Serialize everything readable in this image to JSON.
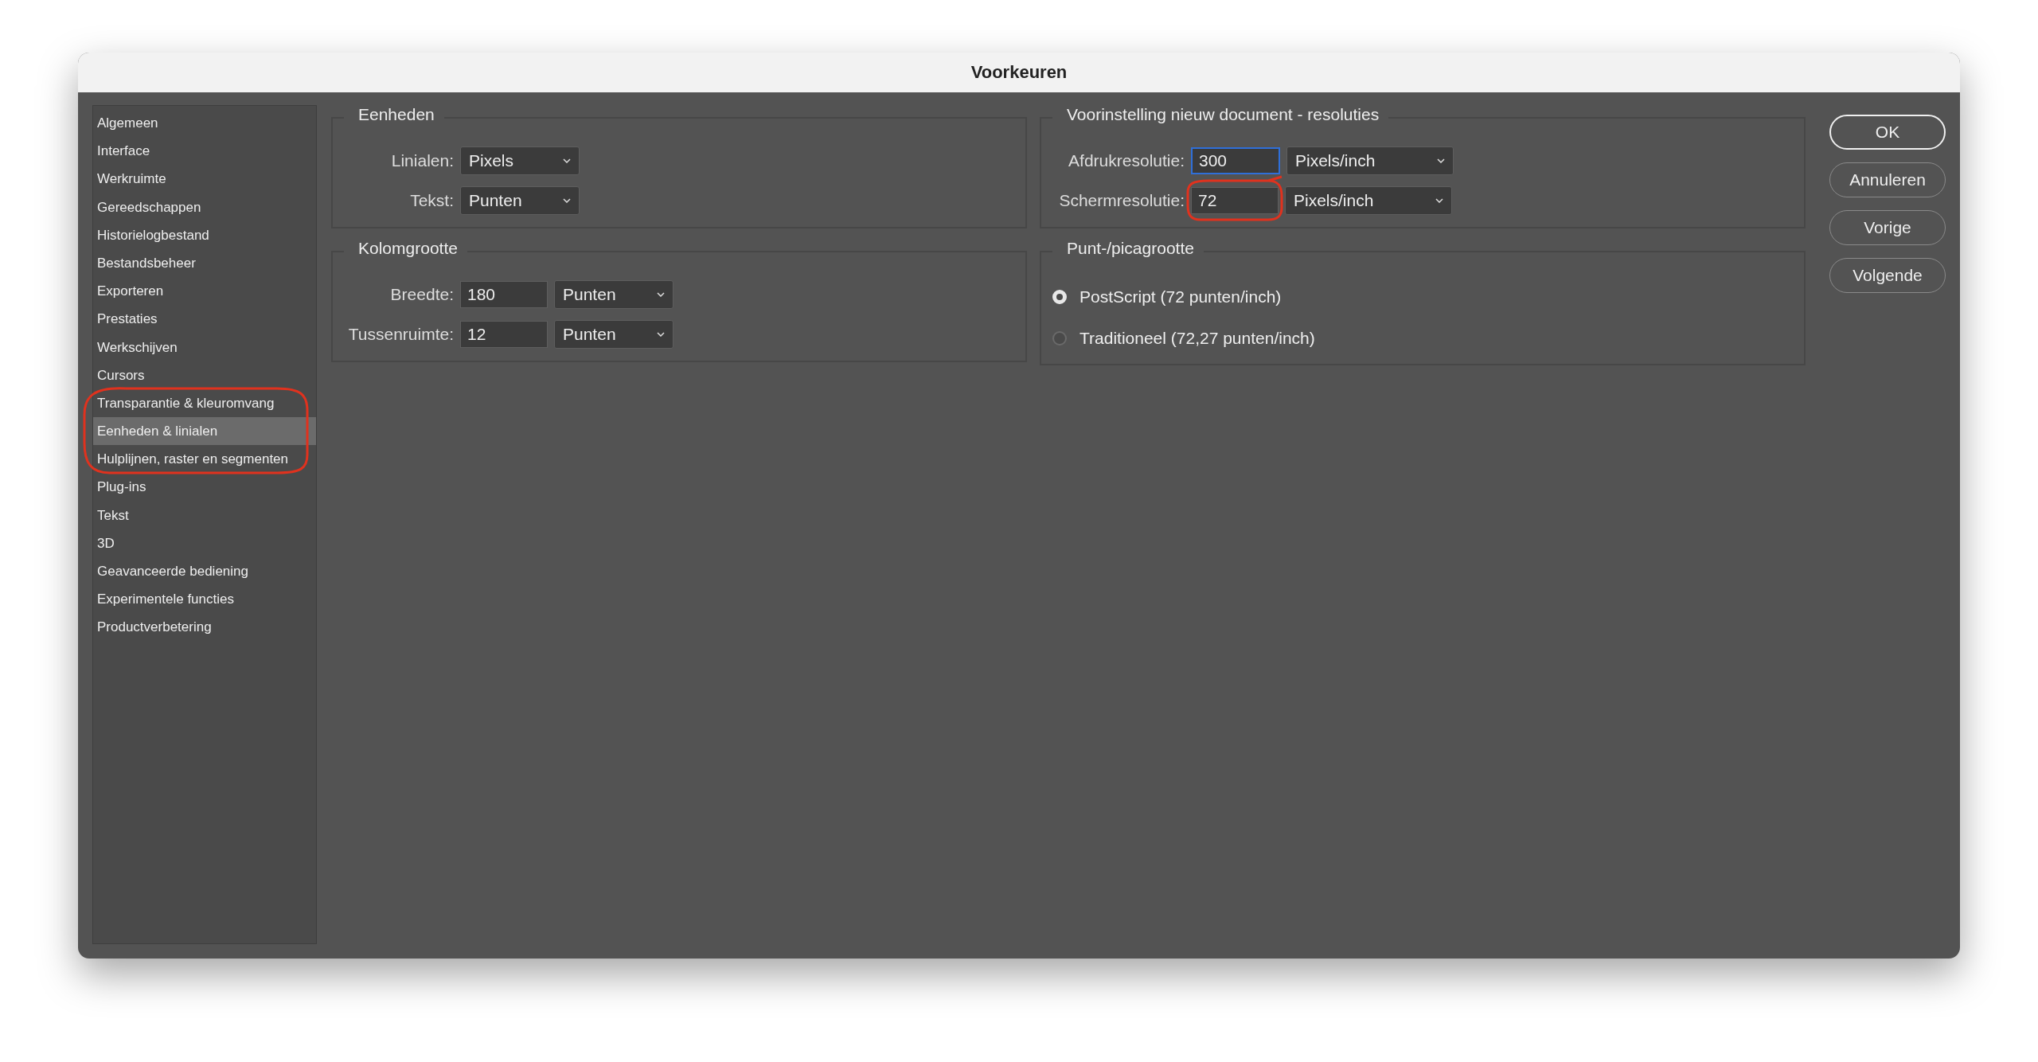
{
  "window": {
    "title": "Voorkeuren"
  },
  "sidebar": {
    "items": [
      {
        "label": "Algemeen",
        "selected": false
      },
      {
        "label": "Interface",
        "selected": false
      },
      {
        "label": "Werkruimte",
        "selected": false
      },
      {
        "label": "Gereedschappen",
        "selected": false
      },
      {
        "label": "Historielogbestand",
        "selected": false
      },
      {
        "label": "Bestandsbeheer",
        "selected": false
      },
      {
        "label": "Exporteren",
        "selected": false
      },
      {
        "label": "Prestaties",
        "selected": false
      },
      {
        "label": "Werkschijven",
        "selected": false
      },
      {
        "label": "Cursors",
        "selected": false
      },
      {
        "label": "Transparantie & kleuromvang",
        "selected": false
      },
      {
        "label": "Eenheden & linialen",
        "selected": true
      },
      {
        "label": "Hulplijnen, raster en segmenten",
        "selected": false
      },
      {
        "label": "Plug-ins",
        "selected": false
      },
      {
        "label": "Tekst",
        "selected": false
      },
      {
        "label": "3D",
        "selected": false
      },
      {
        "label": "Geavanceerde bediening",
        "selected": false
      },
      {
        "label": "Experimentele functies",
        "selected": false
      },
      {
        "label": "Productverbetering",
        "selected": false
      }
    ]
  },
  "columns": [
    {
      "groups": [
        {
          "title": "Eenheden",
          "kind": "form",
          "rows": [
            {
              "label": "Linialen:",
              "kind": "select",
              "unit": "Pixels"
            },
            {
              "label": "Tekst:",
              "kind": "select",
              "unit": "Punten"
            }
          ]
        },
        {
          "title": "Kolomgrootte",
          "kind": "form",
          "rows": [
            {
              "label": "Breedte:",
              "kind": "field_select",
              "value": "180",
              "unit": "Punten",
              "focused": false
            },
            {
              "label": "Tussenruimte:",
              "kind": "field_select",
              "value": "12",
              "unit": "Punten",
              "focused": false
            }
          ]
        }
      ]
    },
    {
      "groups": [
        {
          "title": "Voorinstelling nieuw document - resoluties",
          "kind": "form",
          "rows": [
            {
              "label": "Afdrukresolutie:",
              "kind": "field_select",
              "value": "300",
              "unit": "Pixels/inch",
              "focused": true
            },
            {
              "label": "Schermresolutie:",
              "kind": "field_select",
              "value": "72",
              "unit": "Pixels/inch",
              "focused": false
            }
          ]
        },
        {
          "title": "Punt-/picagrootte",
          "kind": "radios",
          "options": [
            {
              "label": "PostScript (72 punten/inch)",
              "selected": true
            },
            {
              "label": "Traditioneel (72,27 punten/inch)",
              "selected": false
            }
          ]
        }
      ]
    }
  ],
  "buttons": [
    {
      "label": "OK",
      "default": true
    },
    {
      "label": "Annuleren",
      "default": false
    },
    {
      "label": "Vorige",
      "default": false
    },
    {
      "label": "Volgende",
      "default": false
    }
  ]
}
